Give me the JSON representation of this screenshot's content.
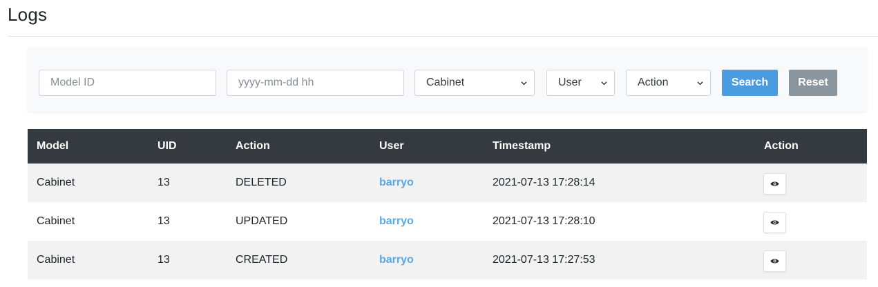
{
  "page": {
    "title": "Logs"
  },
  "filters": {
    "model_id_placeholder": "Model ID",
    "timestamp_placeholder": "yyyy-mm-dd hh",
    "model_select": "Cabinet",
    "user_select": "User",
    "action_select": "Action",
    "search_label": "Search",
    "reset_label": "Reset"
  },
  "table": {
    "headers": {
      "model": "Model",
      "uid": "UID",
      "action": "Action",
      "user": "User",
      "timestamp": "Timestamp",
      "actions": "Action"
    },
    "rows": [
      {
        "model": "Cabinet",
        "uid": "13",
        "action": "DELETED",
        "user": "barryo",
        "timestamp": "2021-07-13 17:28:14",
        "view_icon": "eye-icon"
      },
      {
        "model": "Cabinet",
        "uid": "13",
        "action": "UPDATED",
        "user": "barryo",
        "timestamp": "2021-07-13 17:28:10",
        "view_icon": "eye-icon"
      },
      {
        "model": "Cabinet",
        "uid": "13",
        "action": "CREATED",
        "user": "barryo",
        "timestamp": "2021-07-13 17:27:53",
        "view_icon": "eye-icon"
      }
    ]
  },
  "colors": {
    "header_bg": "#343a40",
    "link": "#5aa9e6",
    "search_button": "#4a9be0",
    "reset_button": "#8b959e"
  }
}
